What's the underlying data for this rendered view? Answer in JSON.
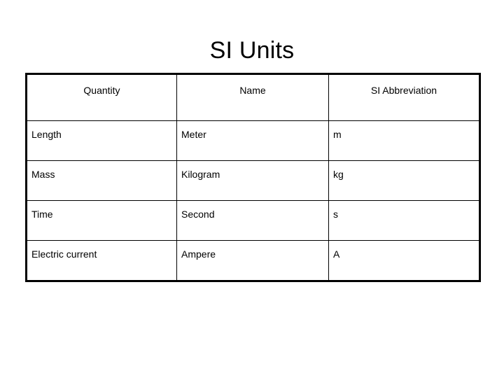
{
  "slide": {
    "title": "SI Units",
    "background_color": "#ffffff",
    "text_color": "#000000",
    "border_color": "#000000"
  },
  "table": {
    "headers": [
      "Quantity",
      "Name",
      "SI Abbreviation"
    ],
    "rows": [
      {
        "quantity": "Length",
        "name": "Meter",
        "abbreviation": "m"
      },
      {
        "quantity": "Mass",
        "name": "Kilogram",
        "abbreviation": "kg"
      },
      {
        "quantity": "Time",
        "name": "Second",
        "abbreviation": "s"
      },
      {
        "quantity": "Electric current",
        "name": "Ampere",
        "abbreviation": "A"
      }
    ]
  }
}
